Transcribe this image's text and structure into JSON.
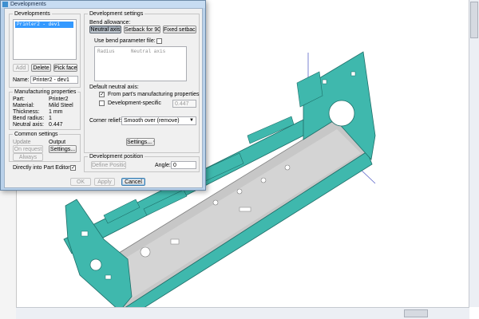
{
  "dialog": {
    "title": "Developments",
    "developments": {
      "group_title": "Developments",
      "list_items": [
        "Printer2 - dev1"
      ],
      "add_label": "Add",
      "delete_label": "Delete",
      "pick_face_label": "Pick face",
      "name_label": "Name:",
      "name_value": "Printer2 - dev1"
    },
    "manufacturing": {
      "group_title": "Manufacturing properties",
      "rows": [
        {
          "label": "Part:",
          "value": "Printer2"
        },
        {
          "label": "Material:",
          "value": "Mild Steel"
        },
        {
          "label": "Thickness:",
          "value": "1 mm"
        },
        {
          "label": "Bend radius:",
          "value": "1"
        },
        {
          "label": "Neutral axis:",
          "value": "0.447"
        }
      ]
    },
    "common": {
      "group_title": "Common settings",
      "update_label": "Update",
      "output_label": "Output",
      "on_request_label": "On request",
      "always_label": "Always",
      "settings_label": "Settings..."
    },
    "directly_label": "Directly into Part Editor:",
    "directly_checked": true,
    "development_settings": {
      "group_title": "Development settings",
      "bend_allowance_label": "Bend allowance:",
      "tabs": [
        "Neutral axis",
        "Setback for 90°",
        "Fixed setback"
      ],
      "use_bend_file_label": "Use bend parameter file:",
      "table_headers": [
        "Radius",
        "Neutral axis"
      ],
      "default_neutral_label": "Default neutral axis:",
      "from_part_label": "From part's manufacturing properties",
      "from_part_checked": true,
      "dev_specific_label": "Development-specific",
      "dev_specific_value": "0.447",
      "corner_relief_label": "Corner relief:",
      "corner_relief_value": "Smooth over (remove)",
      "settings_button_label": "Settings..."
    },
    "development_position": {
      "group_title": "Development position",
      "define_position_label": "Define Position",
      "angle_label": "Angle:",
      "angle_value": "0"
    },
    "ok_label": "OK",
    "apply_label": "Apply",
    "cancel_label": "Cancel"
  },
  "colors": {
    "part_teal": "#3fb8ad",
    "part_edge": "#1e6e68",
    "floor_grey": "#c7c7c7",
    "dialog_frame": "#b9d1ea",
    "selection_blue": "#3399ff"
  },
  "icons": [
    "app-icon",
    "checkmark-icon",
    "dropdown-arrow-icon",
    "settings-expand-icon"
  ]
}
